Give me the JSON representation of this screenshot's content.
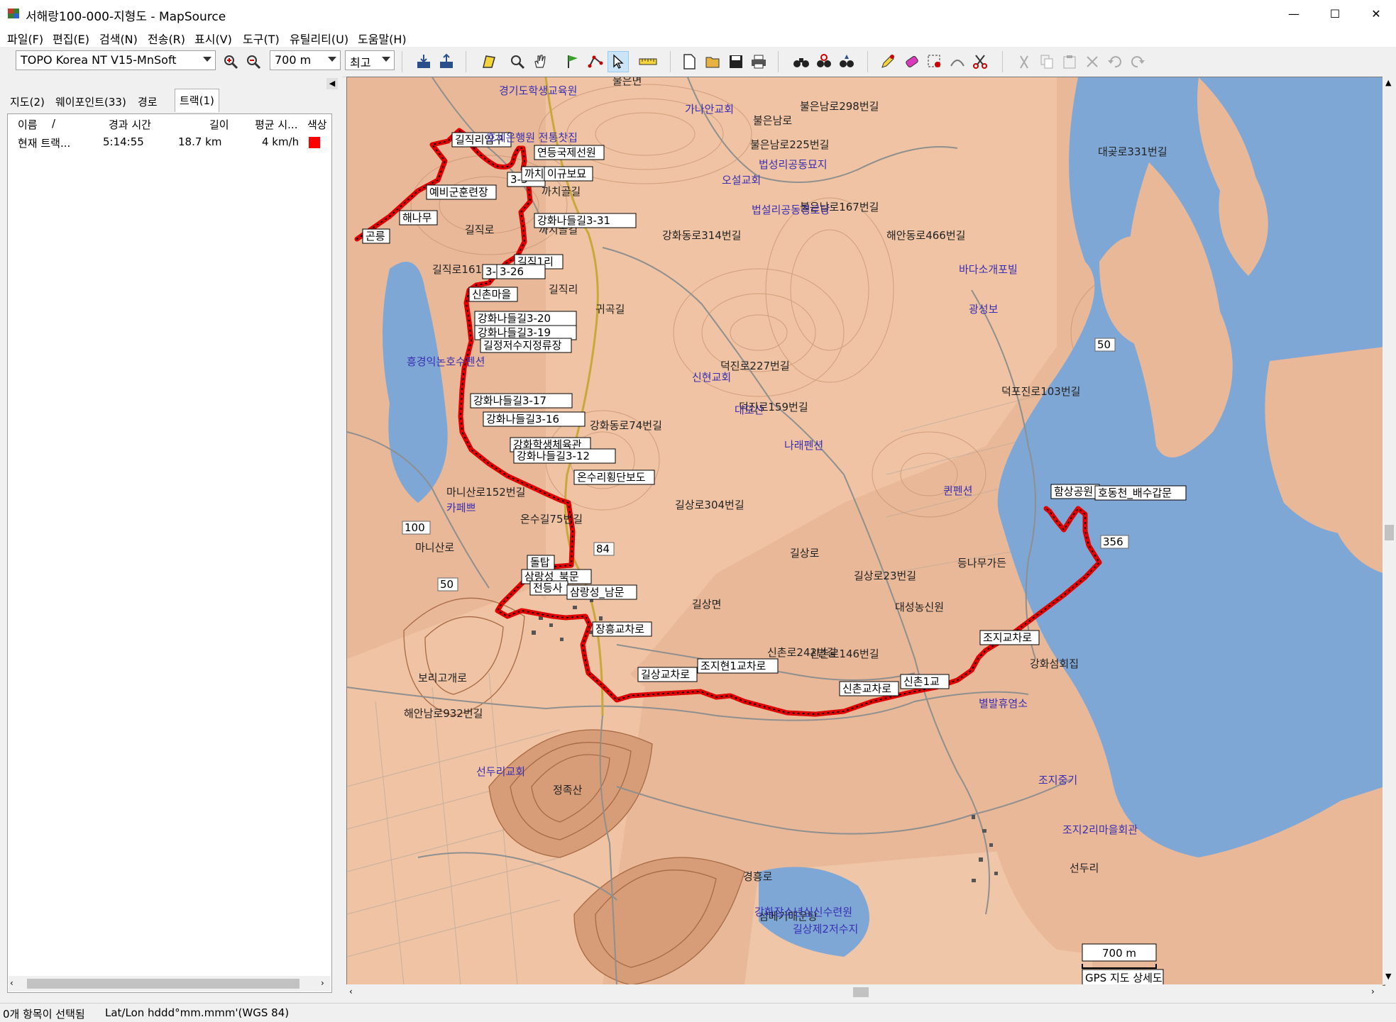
{
  "window": {
    "title": "서해랑100-000-지형도 - MapSource",
    "minimize": "—",
    "maximize": "☐",
    "close": "✕"
  },
  "menu": [
    "파일(F)",
    "편집(E)",
    "검색(N)",
    "전송(R)",
    "표시(V)",
    "도구(T)",
    "유틸리티(U)",
    "도움말(H)"
  ],
  "toolbar": {
    "map_product": "TOPO Korea NT V15-MnSoft",
    "zoom_scale": "700 m",
    "detail": "최고"
  },
  "tabs": [
    "지도(2)",
    "웨이포인트(33)",
    "경로",
    "트랙(1)"
  ],
  "track_list": {
    "headers": [
      "이름",
      "/",
      "경과 시간",
      "길이",
      "평균 시...",
      "색상"
    ],
    "rows": [
      {
        "name": "현재 트랙...",
        "elapsed": "5:14:55",
        "length": "18.7 km",
        "avg_speed": "4 km/h",
        "color": "#ff0000"
      }
    ]
  },
  "status": {
    "selection": "0개 항목이 선택됨",
    "coords": "Lat/Lon hddd°mm.mmm'(WGS 84)"
  },
  "map": {
    "scale_label": "700 m",
    "legend_text": "GPS 지도 상세도",
    "waypoints": [
      "길직리입구",
      "연등국제선원",
      "3-3",
      "까치",
      "이규보묘",
      "예비군훈련장",
      "해나무",
      "곤릉",
      "강화나들길3-31",
      "길직1리",
      "3-2",
      "3-26",
      "신촌마을",
      "강화나들길3-20",
      "강화나들길3-19",
      "길정저수지정류장",
      "강화나들길3-17",
      "강화나들길3-16",
      "강화학생체육관",
      "강화나들길3-12",
      "온수리횡단보도",
      "돌탑",
      "삼랑성_북문",
      "전등사",
      "삼랑성_남문",
      "장흥교차로",
      "길상교차로",
      "조지현1교차로",
      "신촌교차로",
      "신촌1교",
      "조지교차로",
      "함상공원",
      "호동천_배수갑문"
    ],
    "place_labels": [
      "불은면",
      "불은남로",
      "불은남로298번길",
      "불은남로225번길",
      "불은남로167번길",
      "까치골길",
      "까치골길",
      "길직리",
      "길직로",
      "길직로161번길",
      "대곶로331번길",
      "해안동로466번길",
      "귀곡길",
      "강화동로314번길",
      "덕진로227번길",
      "덕진로159번길",
      "덕포진로103번길",
      "강화동로74번길",
      "길상로304번길",
      "길상면",
      "길상로",
      "길상로23번길",
      "마니산로",
      "마니산로152번길",
      "온수길75번길",
      "대성농신원",
      "등나무가든",
      "선두리",
      "강화섬회집",
      "섬메기매운탕",
      "신촌로242번길",
      "신촌로146번길",
      "보리고개로",
      "해안남로932번길",
      "경흥로",
      "정족산"
    ],
    "road_numbers": [
      "84",
      "356",
      "100",
      "50",
      "50"
    ],
    "poi_labels": [
      "가나안교회",
      "경기도학생교육원",
      "호세은행원 전통찻집",
      "법성리공동묘지",
      "오설교회",
      "법설리공동경로당",
      "바다소개포빌",
      "광성보",
      "신현교회",
      "대모산",
      "나래펜션",
      "퀸펜션",
      "카페쁘",
      "흥경익논호수펜션",
      "선두리교회",
      "조지중기",
      "강화장소년심신수련원",
      "길상제2저수지",
      "조지2리마을회관",
      "별발휴염소"
    ]
  }
}
